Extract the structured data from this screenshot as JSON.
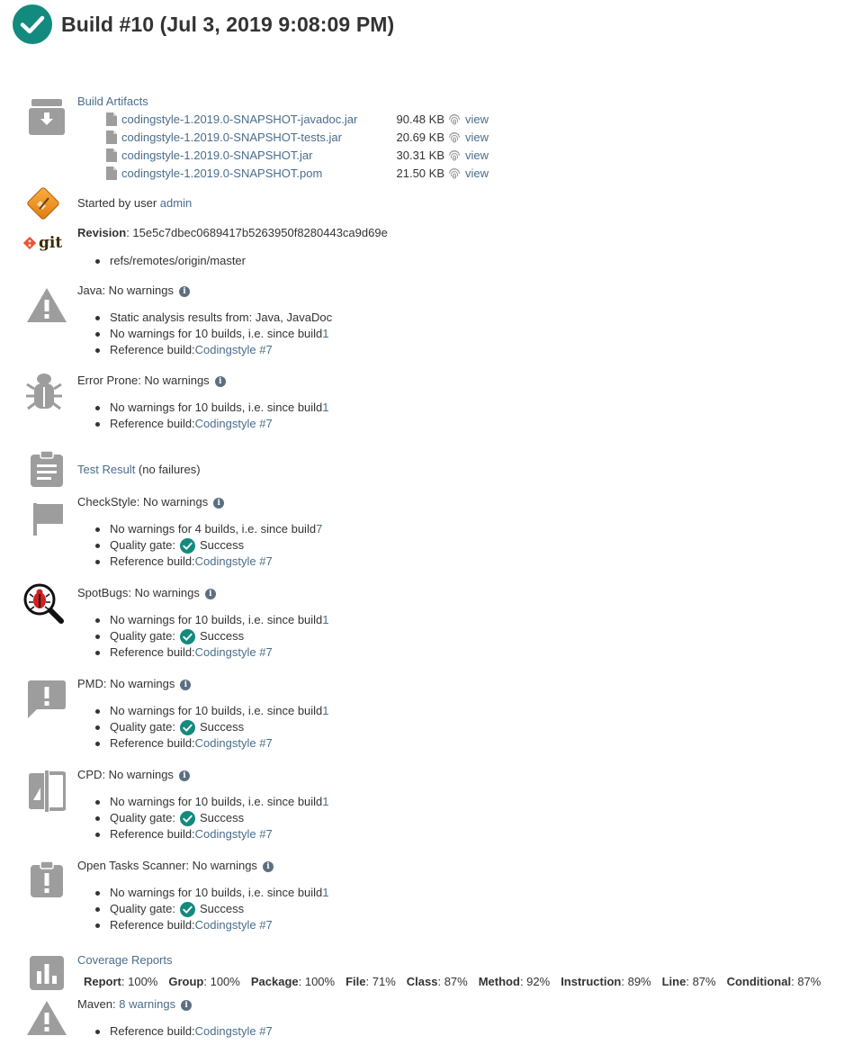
{
  "build": {
    "title": "Build #10 (Jul 3, 2019 9:08:09 PM)"
  },
  "colors": {
    "success": "#138a7e",
    "icon_gray": "#9d9d9d",
    "link": "#4a6d8c"
  },
  "artifacts": {
    "title": "Build Artifacts",
    "view_label": "view",
    "files": [
      {
        "name": "codingstyle-1.2019.0-SNAPSHOT-javadoc.jar",
        "size": "90.48 KB"
      },
      {
        "name": "codingstyle-1.2019.0-SNAPSHOT-tests.jar",
        "size": "20.69 KB"
      },
      {
        "name": "codingstyle-1.2019.0-SNAPSHOT.jar",
        "size": "30.31 KB"
      },
      {
        "name": "codingstyle-1.2019.0-SNAPSHOT.pom",
        "size": "21.50 KB"
      }
    ]
  },
  "started": {
    "prefix": "Started by user ",
    "user": "admin"
  },
  "revision": {
    "label": "Revision",
    "hash": ": 15e5c7dbec0689417b5263950f8280443ca9d69e",
    "branch": "refs/remotes/origin/master",
    "git_text": "git"
  },
  "java": {
    "title": "Java: No warnings",
    "static_analysis": "Static analysis results from: Java, JavaDoc",
    "no_warnings_prefix": "No warnings for 10 builds, i.e. since build ",
    "since_build": "1",
    "ref_prefix": "Reference build: ",
    "ref_link": "Codingstyle #7"
  },
  "errorprone": {
    "title": "Error Prone: No warnings",
    "no_warnings_prefix": "No warnings for 10 builds, i.e. since build ",
    "since_build": "1",
    "ref_prefix": "Reference build: ",
    "ref_link": "Codingstyle #7"
  },
  "testresult": {
    "link": "Test Result",
    "suffix": " (no failures)"
  },
  "checkstyle": {
    "title": "CheckStyle: No warnings",
    "no_warnings_prefix": "No warnings for 4 builds, i.e. since build ",
    "since_build": "7",
    "qg_prefix": "Quality gate: ",
    "qg_status": "Success",
    "ref_prefix": "Reference build: ",
    "ref_link": "Codingstyle #7"
  },
  "spotbugs": {
    "title": "SpotBugs: No warnings",
    "no_warnings_prefix": "No warnings for 10 builds, i.e. since build ",
    "since_build": "1",
    "qg_prefix": "Quality gate: ",
    "qg_status": "Success",
    "ref_prefix": "Reference build: ",
    "ref_link": "Codingstyle #7"
  },
  "pmd": {
    "title": "PMD: No warnings",
    "no_warnings_prefix": "No warnings for 10 builds, i.e. since build ",
    "since_build": "1",
    "qg_prefix": "Quality gate: ",
    "qg_status": "Success",
    "ref_prefix": "Reference build: ",
    "ref_link": "Codingstyle #7"
  },
  "cpd": {
    "title": "CPD: No warnings",
    "no_warnings_prefix": "No warnings for 10 builds, i.e. since build ",
    "since_build": "1",
    "qg_prefix": "Quality gate: ",
    "qg_status": "Success",
    "ref_prefix": "Reference build: ",
    "ref_link": "Codingstyle #7"
  },
  "opentasks": {
    "title": "Open Tasks Scanner: No warnings",
    "no_warnings_prefix": "No warnings for 10 builds, i.e. since build ",
    "since_build": "1",
    "qg_prefix": "Quality gate: ",
    "qg_status": "Success",
    "ref_prefix": "Reference build: ",
    "ref_link": "Codingstyle #7"
  },
  "coverage": {
    "title": "Coverage Reports",
    "metrics": [
      {
        "label": "Report",
        "value": ": 100%"
      },
      {
        "label": "Group",
        "value": ": 100%"
      },
      {
        "label": "Package",
        "value": ": 100%"
      },
      {
        "label": "File",
        "value": ": 71%"
      },
      {
        "label": "Class",
        "value": ": 87%"
      },
      {
        "label": "Method",
        "value": ": 92%"
      },
      {
        "label": "Instruction",
        "value": ": 89%"
      },
      {
        "label": "Line",
        "value": ": 87%"
      },
      {
        "label": "Conditional",
        "value": ": 87%"
      }
    ]
  },
  "maven": {
    "prefix": "Maven: ",
    "link": "8 warnings",
    "ref_prefix": "Reference build: ",
    "ref_link": "Codingstyle #7"
  }
}
